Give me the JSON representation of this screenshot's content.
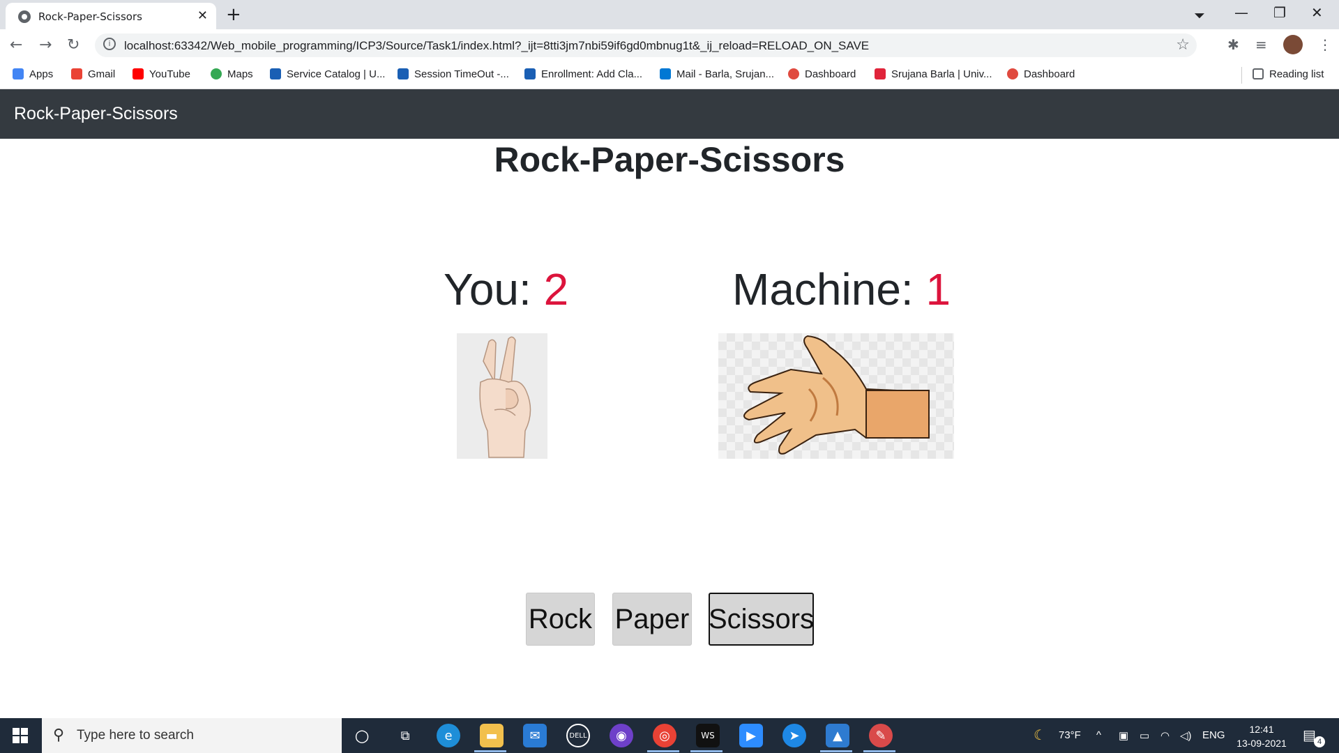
{
  "browser": {
    "tab_title": "Rock-Paper-Scissors",
    "url": "localhost:63342/Web_mobile_programming/ICP3/Source/Task1/index.html?_ijt=8tti3jm7nbi59if6gd0mbnug1t&_ij_reload=RELOAD_ON_SAVE"
  },
  "bookmarks": {
    "items": [
      {
        "label": "Apps",
        "color": "#4285f4"
      },
      {
        "label": "Gmail",
        "color": "#ea4335"
      },
      {
        "label": "YouTube",
        "color": "#ff0000"
      },
      {
        "label": "Maps",
        "color": "#34a853"
      },
      {
        "label": "Service Catalog | U...",
        "color": "#1a5fb4"
      },
      {
        "label": "Session TimeOut -...",
        "color": "#1a5fb4"
      },
      {
        "label": "Enrollment: Add Cla...",
        "color": "#1a5fb4"
      },
      {
        "label": "Mail - Barla, Srujan...",
        "color": "#0078d4"
      },
      {
        "label": "Dashboard",
        "color": "#e04a3f"
      },
      {
        "label": "Srujana Barla | Univ...",
        "color": "#e0243a"
      },
      {
        "label": "Dashboard",
        "color": "#e04a3f"
      }
    ],
    "reading_list": "Reading list"
  },
  "app": {
    "brand": "Rock-Paper-Scissors",
    "title": "Rock-Paper-Scissors",
    "player_label": "You: ",
    "player_score": "2",
    "machine_label": "Machine: ",
    "machine_score": "1",
    "player_choice": "scissors",
    "machine_choice": "paper",
    "buttons": {
      "rock": "Rock",
      "paper": "Paper",
      "scissors": "Scissors"
    }
  },
  "taskbar": {
    "search_placeholder": "Type here to search",
    "weather": "73°F",
    "language": "ENG",
    "time": "12:41",
    "date": "13-09-2021",
    "notifications": "4"
  }
}
